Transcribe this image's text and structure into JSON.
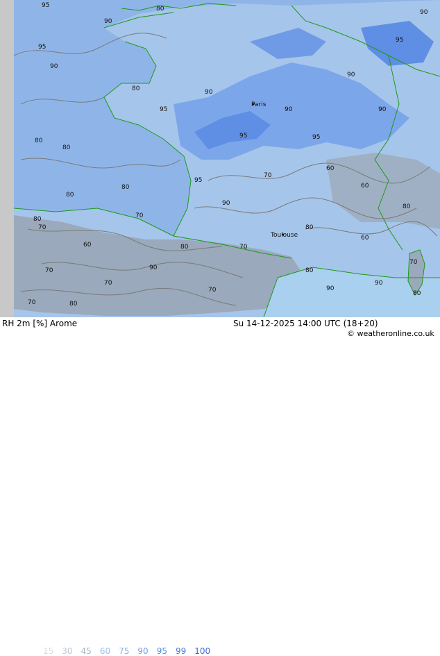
{
  "map": {
    "places": [
      "Paris",
      "Toulouse"
    ],
    "contour_labels": [
      "95",
      "90",
      "80",
      "70",
      "60"
    ]
  },
  "footer": {
    "product": "RH 2m [%] Arome",
    "valid_time": "Su 14-12-2025 14:00 UTC (18+20)",
    "credit": "© weatheronline.co.uk",
    "legend": [
      {
        "value": "15",
        "color": "#d6dbe2"
      },
      {
        "value": "30",
        "color": "#bcc6d2"
      },
      {
        "value": "45",
        "color": "#a7b4c4"
      },
      {
        "value": "60",
        "color": "#9fc0e8"
      },
      {
        "value": "75",
        "color": "#88b2e6"
      },
      {
        "value": "90",
        "color": "#6f9fe0"
      },
      {
        "value": "95",
        "color": "#5a8de0"
      },
      {
        "value": "99",
        "color": "#4a7bd8"
      },
      {
        "value": "100",
        "color": "#3a6bd0"
      }
    ]
  }
}
